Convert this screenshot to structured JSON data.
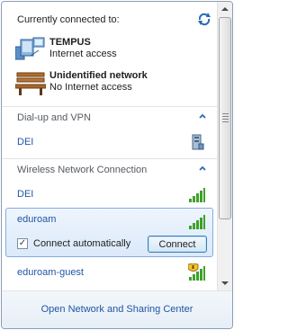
{
  "header": {
    "title": "Currently connected to:"
  },
  "current_connections": [
    {
      "name": "TEMPUS",
      "status": "Internet access",
      "icon": "network-computers-icon"
    },
    {
      "name": "Unidentified network",
      "status": "No Internet access",
      "icon": "park-bench-icon"
    }
  ],
  "sections": [
    {
      "title": "Dial-up and VPN",
      "items": [
        {
          "name": "DEI",
          "icon": "vpn-server-icon"
        }
      ]
    },
    {
      "title": "Wireless Network Connection",
      "items": [
        {
          "name": "DEI",
          "icon": "wifi-signal-icon"
        },
        {
          "name": "eduroam",
          "icon": "wifi-signal-icon",
          "selected": true
        },
        {
          "name": "eduroam-guest",
          "icon": "wifi-signal-shield-icon"
        }
      ]
    }
  ],
  "selected_network": {
    "connect_automatically_label": "Connect automatically",
    "connect_automatically_checked": true,
    "checkbox_mark": "✓",
    "connect_button_label": "Connect"
  },
  "footer": {
    "link_label": "Open Network and Sharing Center"
  },
  "colors": {
    "link": "#1f56a4",
    "section_text": "#555a62",
    "selection_border": "#84acdd",
    "signal_green": "#3fa02b"
  }
}
